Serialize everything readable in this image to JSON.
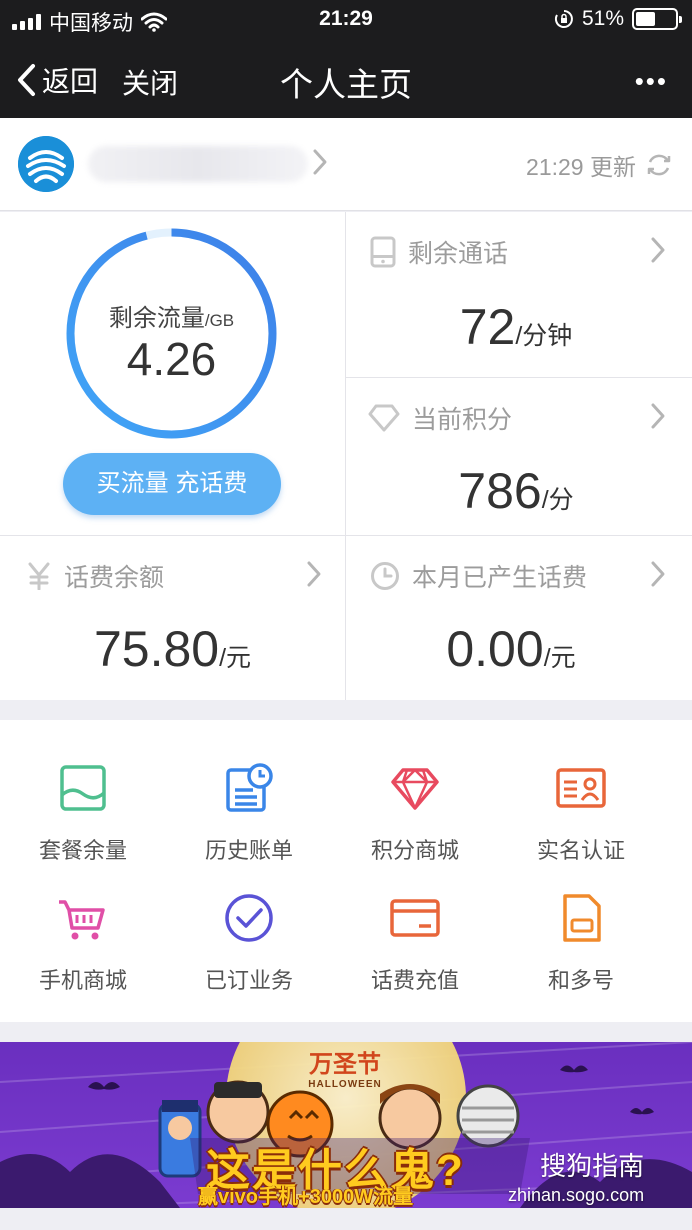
{
  "status_bar": {
    "carrier": "中国移动",
    "time": "21:29",
    "battery": "51%",
    "battery_level": 0.51
  },
  "nav": {
    "back_label": "返回",
    "close_label": "关闭",
    "title": "个人主页",
    "more_label": "•••"
  },
  "account": {
    "refresh_text": "21:29 更新"
  },
  "data": {
    "label": "剩余流量",
    "unit": "/GB",
    "value": "4.26",
    "ring_fraction": 0.96,
    "button_label": "买流量 充话费"
  },
  "calls": {
    "label": "剩余通话",
    "value": "72",
    "unit": "/分钟"
  },
  "points": {
    "label": "当前积分",
    "value": "786",
    "unit": "/分"
  },
  "balance": {
    "label": "话费余额",
    "value": "75.80",
    "unit": "/元"
  },
  "monthly": {
    "label": "本月已产生话费",
    "value": "0.00",
    "unit": "/元"
  },
  "services": [
    {
      "label": "套餐余量",
      "icon": "package-icon",
      "color": "#4fbf8f"
    },
    {
      "label": "历史账单",
      "icon": "bill-history-icon",
      "color": "#3a86e8"
    },
    {
      "label": "积分商城",
      "icon": "diamond-icon",
      "color": "#e84a5f"
    },
    {
      "label": "实名认证",
      "icon": "id-card-icon",
      "color": "#e8663a"
    },
    {
      "label": "手机商城",
      "icon": "shopping-cart-icon",
      "color": "#e04fa7"
    },
    {
      "label": "已订业务",
      "icon": "check-circle-icon",
      "color": "#5a53d6"
    },
    {
      "label": "话费充值",
      "icon": "card-icon",
      "color": "#e8663a"
    },
    {
      "label": "和多号",
      "icon": "sim-icon",
      "color": "#f08a2c"
    }
  ],
  "banner": {
    "festival": "万圣节",
    "festival_en": "HALLOWEEN",
    "headline": "这是什么鬼?",
    "subline": "赢vivo手机+3000W流量",
    "watermark": "搜狗指南",
    "watermark_url": "zhinan.sogo.com"
  }
}
